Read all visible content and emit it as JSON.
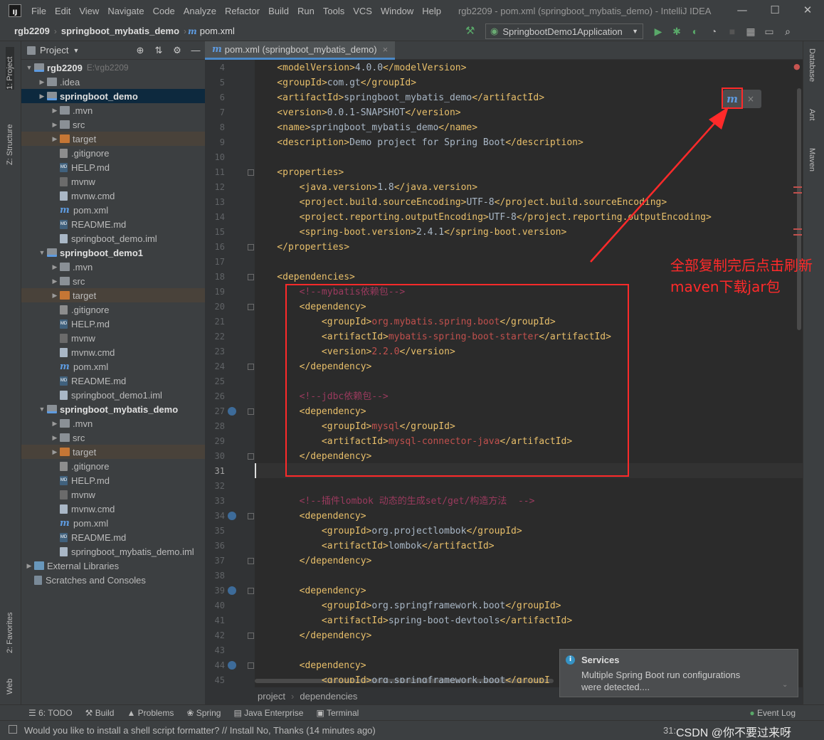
{
  "window": {
    "logo": "IJ",
    "menu": [
      "File",
      "Edit",
      "View",
      "Navigate",
      "Code",
      "Analyze",
      "Refactor",
      "Build",
      "Run",
      "Tools",
      "VCS",
      "Window",
      "Help"
    ],
    "title": "rgb2209 - pom.xml (springboot_mybatis_demo) - IntelliJ IDEA",
    "min": "—",
    "max": "☐",
    "close": "✕"
  },
  "navbar": {
    "crumbs": [
      "rgb2209",
      "springboot_mybatis_demo",
      "pom.xml"
    ],
    "run_config": "SpringbootDemo1Application"
  },
  "left_strip": {
    "project": "1: Project",
    "structure": "Z: Structure",
    "favorites": "2: Favorites",
    "web": "Web"
  },
  "right_strip": {
    "database": "Database",
    "ant": "Ant",
    "maven": "Maven"
  },
  "project_panel": {
    "title": "Project",
    "root_name": "rgb2209",
    "root_path": "E:\\rgb2209",
    "rows": [
      {
        "label": "rgb2209",
        "path": "E:\\rgb2209"
      },
      {
        "label": ".idea"
      },
      {
        "label": "springboot_demo"
      },
      {
        "label": ".mvn"
      },
      {
        "label": "src"
      },
      {
        "label": "target"
      },
      {
        "label": ".gitignore"
      },
      {
        "label": "HELP.md"
      },
      {
        "label": "mvnw"
      },
      {
        "label": "mvnw.cmd"
      },
      {
        "label": "pom.xml"
      },
      {
        "label": "README.md"
      },
      {
        "label": "springboot_demo.iml"
      },
      {
        "label": "springboot_demo1"
      },
      {
        "label": ".mvn"
      },
      {
        "label": "src"
      },
      {
        "label": "target"
      },
      {
        "label": ".gitignore"
      },
      {
        "label": "HELP.md"
      },
      {
        "label": "mvnw"
      },
      {
        "label": "mvnw.cmd"
      },
      {
        "label": "pom.xml"
      },
      {
        "label": "README.md"
      },
      {
        "label": "springboot_demo1.iml"
      },
      {
        "label": "springboot_mybatis_demo"
      },
      {
        "label": ".mvn"
      },
      {
        "label": "src"
      },
      {
        "label": "target"
      },
      {
        "label": ".gitignore"
      },
      {
        "label": "HELP.md"
      },
      {
        "label": "mvnw"
      },
      {
        "label": "mvnw.cmd"
      },
      {
        "label": "pom.xml"
      },
      {
        "label": "README.md"
      },
      {
        "label": "springboot_mybatis_demo.iml"
      },
      {
        "label": "External Libraries"
      },
      {
        "label": "Scratches and Consoles"
      }
    ]
  },
  "editor": {
    "tab": "pom.xml (springboot_mybatis_demo)",
    "line_numbers": [
      "4",
      "5",
      "6",
      "7",
      "8",
      "9",
      "10",
      "11",
      "12",
      "13",
      "14",
      "15",
      "16",
      "17",
      "18",
      "19",
      "20",
      "21",
      "22",
      "23",
      "24",
      "25",
      "26",
      "27",
      "28",
      "29",
      "30",
      "31",
      "32",
      "33",
      "34",
      "35",
      "36",
      "37",
      "38",
      "39",
      "40",
      "41",
      "42",
      "43",
      "44",
      "45"
    ],
    "lines": [
      {
        "i": "    ",
        "t": "modelVersion",
        "v": "4.0.0"
      },
      {
        "i": "    ",
        "t": "groupId",
        "v": "com.gt"
      },
      {
        "i": "    ",
        "t": "artifactId",
        "v": "springboot_mybatis_demo"
      },
      {
        "i": "    ",
        "t": "version",
        "v": "0.0.1-SNAPSHOT"
      },
      {
        "i": "    ",
        "t": "name",
        "v": "springboot_mybatis_demo"
      },
      {
        "i": "    ",
        "t": "description",
        "v": "Demo project for Spring Boot"
      },
      {
        "raw": ""
      },
      {
        "open": "    <properties>"
      },
      {
        "i": "        ",
        "t": "java.version",
        "v": "1.8"
      },
      {
        "i": "        ",
        "t": "project.build.sourceEncoding",
        "v": "UTF-8"
      },
      {
        "i": "        ",
        "t": "project.reporting.outputEncoding",
        "v": "UTF-8"
      },
      {
        "i": "        ",
        "t": "spring-boot.version",
        "v": "2.4.1"
      },
      {
        "open": "    </properties>"
      },
      {
        "raw": ""
      },
      {
        "open": "    <dependencies>"
      },
      {
        "comment": "        <!--mybatis依赖包-->"
      },
      {
        "open": "        <dependency>"
      },
      {
        "i": "            ",
        "t": "groupId",
        "v": "org.mybatis.spring.boot",
        "red": true
      },
      {
        "i": "            ",
        "t": "artifactId",
        "v": "mybatis-spring-boot-starter",
        "red": true
      },
      {
        "i": "            ",
        "t": "version",
        "v": "2.2.0",
        "red": true
      },
      {
        "open": "        </dependency>"
      },
      {
        "raw": ""
      },
      {
        "comment": "        <!--jdbc依赖包-->"
      },
      {
        "open": "        <dependency>"
      },
      {
        "i": "            ",
        "t": "groupId",
        "v": "mysql",
        "red": true
      },
      {
        "i": "            ",
        "t": "artifactId",
        "v": "mysql-connector-java",
        "red": true
      },
      {
        "open": "        </dependency>"
      },
      {
        "raw": ""
      },
      {
        "raw": ""
      },
      {
        "comment": "        <!--插件lombok 动态的生成set/get/构造方法  -->"
      },
      {
        "open": "        <dependency>"
      },
      {
        "i": "            ",
        "t": "groupId",
        "v": "org.projectlombok"
      },
      {
        "i": "            ",
        "t": "artifactId",
        "v": "lombok"
      },
      {
        "open": "        </dependency>"
      },
      {
        "raw": ""
      },
      {
        "open": "        <dependency>"
      },
      {
        "i": "            ",
        "t": "groupId",
        "v": "org.springframework.boot"
      },
      {
        "i": "            ",
        "t": "artifactId",
        "v": "spring-boot-devtools"
      },
      {
        "open": "        </dependency>"
      },
      {
        "raw": ""
      },
      {
        "open": "        <dependency>"
      },
      {
        "i": "            ",
        "t": "groupId",
        "v": "org.springframework.boot",
        "cut": "</groupI"
      }
    ],
    "breadcrumb": [
      "project",
      "dependencies"
    ]
  },
  "services_popup": {
    "title": "Services",
    "body": "Multiple Spring Boot run configurations were detected...."
  },
  "bottom_tools": [
    "6: TODO",
    "Build",
    "Problems",
    "Spring",
    "Java Enterprise",
    "Terminal"
  ],
  "event_log": "Event Log",
  "status": {
    "message": "Would you like to install a shell script formatter? // Install    No, Thanks (14 minutes ago)",
    "position": "31:",
    "watermark": "CSDN @你不要过来呀"
  },
  "annotation": {
    "line1": "全部复制完后点击刷新",
    "line2": "maven下载jar包",
    "color": "#ff2a2a"
  }
}
